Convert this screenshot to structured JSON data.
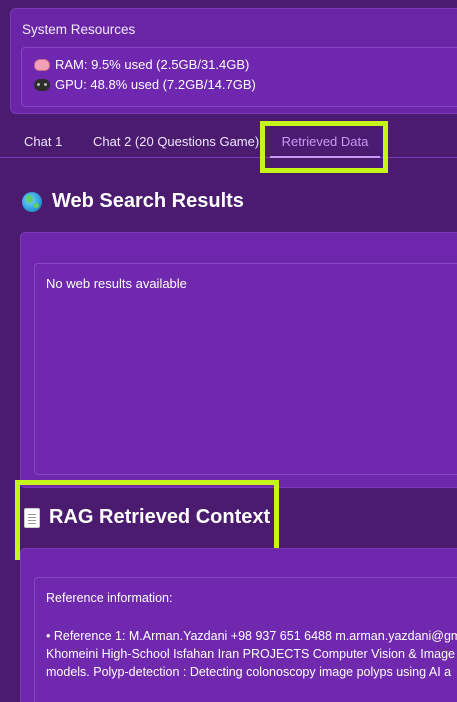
{
  "system_resources": {
    "title": "System Resources",
    "ram_text": "RAM: 9.5% used (2.5GB/31.4GB)",
    "gpu_text": "GPU: 48.8% used (7.2GB/14.7GB)"
  },
  "tabs": [
    {
      "label": "Chat 1",
      "active": false
    },
    {
      "label": "Chat 2 (20 Questions Game)",
      "active": false
    },
    {
      "label": "Retrieved Data",
      "active": true
    }
  ],
  "web_search": {
    "title": "Web Search Results",
    "empty_message": "No web results available"
  },
  "rag": {
    "title": "RAG Retrieved Context",
    "intro": "Reference information:",
    "lines": [
      "• Reference 1: M.Arman.Yazdani +98 937 651 6488 m.arman.yazdani@gm",
      "Khomeini High-School Isfahan Iran PROJECTS Computer Vision & Image",
      "models. Polyp-detection : Detecting colonoscopy image polyps using AI a"
    ]
  },
  "colors": {
    "background": "#4a1b6e",
    "panel": "#6e26ac",
    "active_tab": "#c59bf7",
    "highlight": "#c6f51c"
  }
}
